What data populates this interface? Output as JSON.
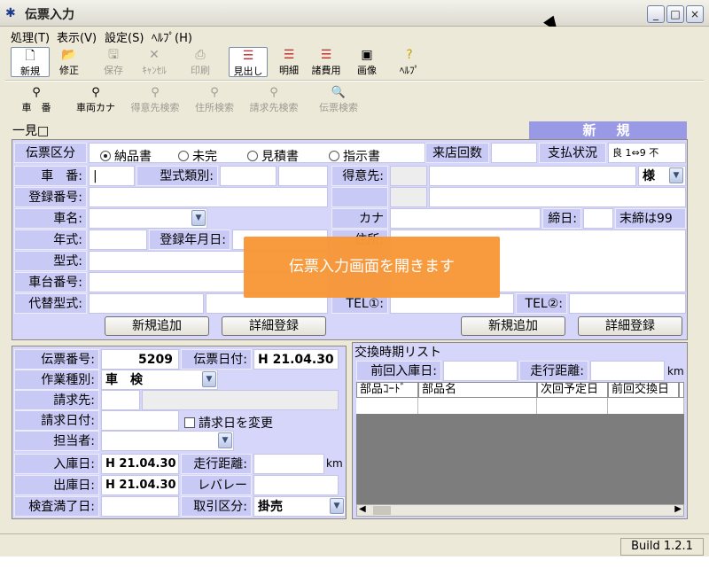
{
  "window": {
    "title": "伝票入力",
    "minimize": "_",
    "maximize": "□",
    "close": "×"
  },
  "menu": [
    "処理(T)",
    "表示(V)",
    "設定(S)",
    "ﾍﾙﾌﾟ(H)"
  ],
  "toolbar1": {
    "new": "新規",
    "edit": "修正",
    "save": "保存",
    "cancel": "ｷｬﾝｾﾙ",
    "print": "印刷",
    "header": "見出し",
    "detail": "明細",
    "expenses": "諸費用",
    "image": "画像",
    "help": "ﾍﾙﾌﾟ"
  },
  "toolbar2": {
    "car_no": "車　番",
    "car_kana": "車両カナ",
    "customer_search": "得意先検索",
    "address_search": "住所検索",
    "billing_search": "請求先検索",
    "slip_search": "伝票検索"
  },
  "list_toggle": "一見□",
  "mode_label": "新　規",
  "slip_type": {
    "label": "伝票区分",
    "options": [
      "納品書",
      "未完",
      "見積書",
      "指示書"
    ],
    "selected": 0
  },
  "visit_count_label": "来店回数",
  "payment_status_label": "支払状況",
  "payment_status_value": "良 1⇔9 不",
  "vehicle": {
    "car_number_label": "車　番:",
    "car_number_value": "|",
    "model_class_label": "型式類別:",
    "registration_label": "登録番号:",
    "car_name_label": "車名:",
    "year_label": "年式:",
    "reg_date_label": "登録年月日:",
    "model_label": "型式:",
    "chassis_label": "車台番号:",
    "alt_model_label": "代替型式:",
    "add_button": "新規追加",
    "detail_button": "詳細登録"
  },
  "customer": {
    "customer_label": "得意先:",
    "honorific": "様",
    "kana_label": "カナ",
    "closing_label": "締日:",
    "closing_note": "末締は99",
    "address_label": "住所:",
    "tel1_label": "TEL①:",
    "tel2_label": "TEL②:",
    "add_button": "新規追加",
    "detail_button": "詳細登録"
  },
  "toast": "伝票入力画面を開きます",
  "slip": {
    "number_label": "伝票番号:",
    "number_value": "5209",
    "date_label": "伝票日付:",
    "date_value": "H 21.04.30",
    "work_type_label": "作業種別:",
    "work_type_value": "車　検",
    "billing_label": "請求先:",
    "billing_date_label": "請求日付:",
    "change_billing_date": "請求日を変更",
    "staff_label": "担当者:",
    "entry_date_label": "入庫日:",
    "entry_date_value": "H 21.04.30",
    "mileage_label": "走行距離:",
    "km": "km",
    "exit_date_label": "出庫日:",
    "exit_date_value": "H 21.04.30",
    "rate_label": "レバレート:",
    "inspection_label": "検査満了日:",
    "trade_label": "取引区分:",
    "trade_value": "掛売"
  },
  "exchange": {
    "title": "交換時期リスト",
    "last_entry_label": "前回入庫日:",
    "mileage_label": "走行距離:",
    "km": "km",
    "columns": [
      "部品ｺｰﾄﾞ",
      "部品名",
      "次回予定日",
      "前回交換日"
    ]
  },
  "status_bar": {
    "build": "Build 1.2.1"
  }
}
